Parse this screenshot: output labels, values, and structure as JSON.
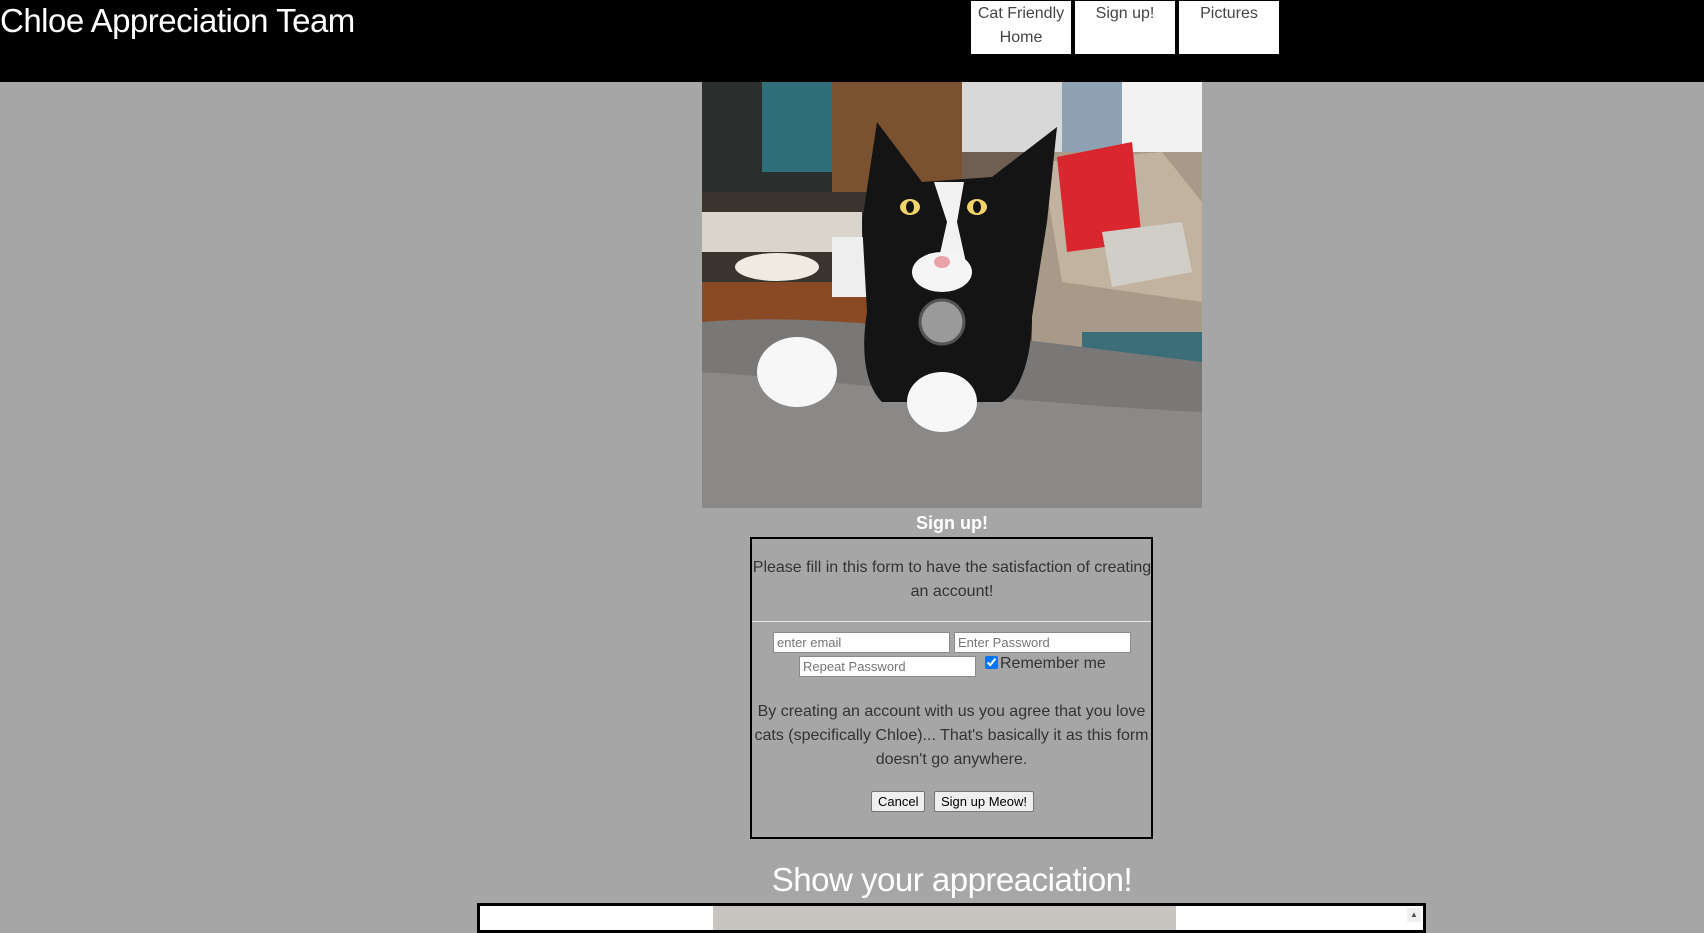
{
  "header": {
    "title": "Chloe Appreciation Team",
    "nav": [
      "Cat Friendly Home",
      "Sign up!",
      "Pictures"
    ]
  },
  "hero": {
    "image": "tuxedo-cat-photo"
  },
  "signup": {
    "heading": "Sign up!",
    "intro": "Please fill in this form to have the satisfaction of creating an account!",
    "email_placeholder": "enter email",
    "password_placeholder": "Enter Password",
    "repeat_placeholder": "Repeat Password",
    "remember_label": "Remember me",
    "remember_checked": true,
    "terms": "By creating an account with us you agree that you love cats (specifically Chloe)... That's basically it as this form doesn't go anywhere.",
    "cancel_label": "Cancel",
    "submit_label": "Sign up Meow!"
  },
  "appreciation": {
    "heading": "Show your appreaciation!"
  },
  "colors": {
    "page_bg": "#a6a6a6",
    "header_bg": "#000000",
    "checkbox_accent": "#0075ff"
  }
}
